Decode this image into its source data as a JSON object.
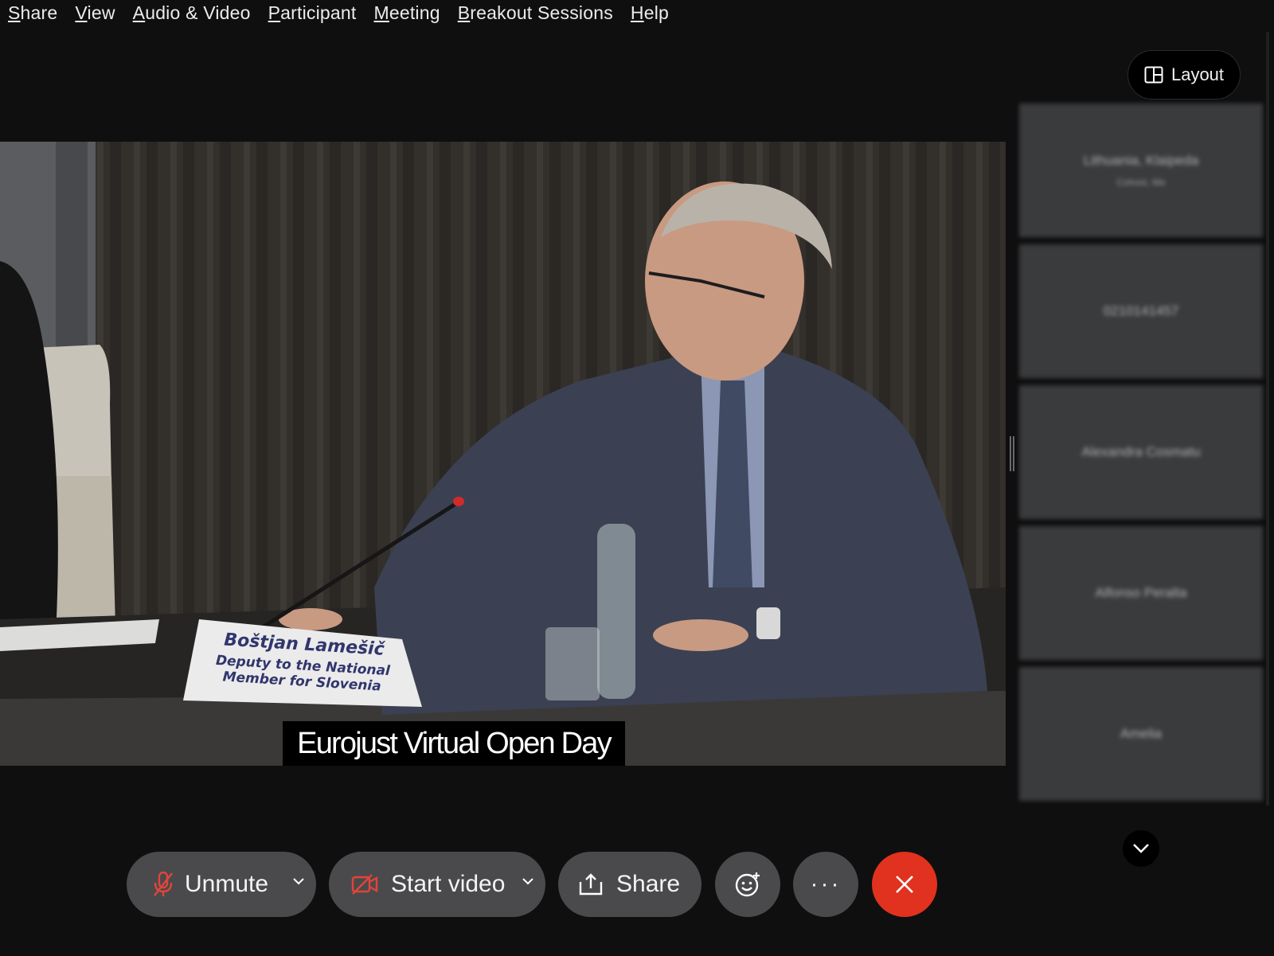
{
  "menu": {
    "items": [
      {
        "label": "Share",
        "accesskey_index": 0
      },
      {
        "label": "View",
        "accesskey_index": 0
      },
      {
        "label": "Audio & Video",
        "accesskey_index": 0
      },
      {
        "label": "Participant",
        "accesskey_index": 0
      },
      {
        "label": "Meeting",
        "accesskey_index": 0
      },
      {
        "label": "Breakout Sessions",
        "accesskey_index": 0
      },
      {
        "label": "Help",
        "accesskey_index": 0
      }
    ]
  },
  "layout_button": {
    "label": "Layout",
    "icon": "layout-icon"
  },
  "main_video": {
    "caption": "Eurojust Virtual Open Day",
    "name_card": {
      "line1": "Boštjan Lamešič",
      "line2": "Deputy to the National",
      "line3": "Member for Slovenia"
    }
  },
  "participants": [
    {
      "name": "Lithuania, Klaipeda",
      "sub": "Cohost, Me"
    },
    {
      "name": "0210141457",
      "sub": ""
    },
    {
      "name": "Alexandra Cosmatu",
      "sub": ""
    },
    {
      "name": "Alfonso Peralta",
      "sub": ""
    },
    {
      "name": "Amelia",
      "sub": ""
    }
  ],
  "controls": {
    "unmute": {
      "label": "Unmute",
      "icon": "muted-mic-icon"
    },
    "start_video": {
      "label": "Start video",
      "icon": "video-off-icon"
    },
    "share": {
      "label": "Share",
      "icon": "share-icon"
    },
    "reactions": {
      "icon": "smiley-icon"
    },
    "more": {
      "label": "···",
      "icon": "more-icon"
    },
    "leave": {
      "icon": "close-icon"
    }
  },
  "colors": {
    "background": "#0f0f10",
    "control_bg": "#4a4a4c",
    "leave_red": "#e0321e",
    "mic_off_red": "#e0453a",
    "tile_bg": "#3a3b3d"
  }
}
